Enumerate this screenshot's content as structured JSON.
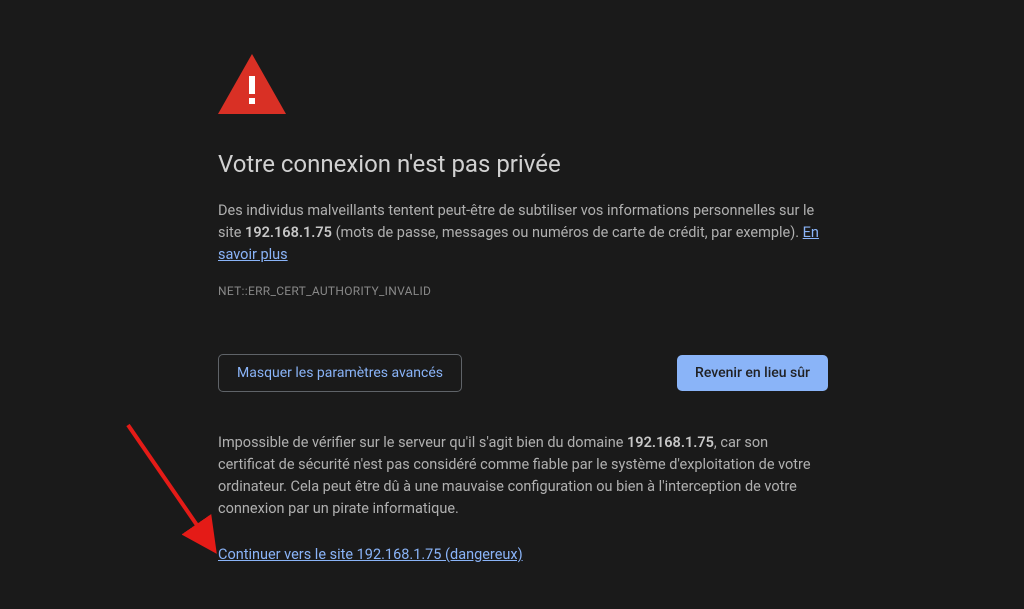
{
  "ip": "192.168.1.75",
  "title": "Votre connexion n'est pas privée",
  "body": {
    "prefix": "Des individus malveillants tentent peut-être de subtiliser vos informations personnelles sur le site ",
    "bold": "192.168.1.75",
    "suffix": " (mots de passe, messages ou numéros de carte de crédit, par exemple). ",
    "learn_more": "En savoir plus"
  },
  "error_code": "NET::ERR_CERT_AUTHORITY_INVALID",
  "buttons": {
    "hide_advanced": "Masquer les paramètres avancés",
    "back_safe": "Revenir en lieu sûr"
  },
  "details": {
    "prefix": "Impossible de vérifier sur le serveur qu'il s'agit bien du domaine ",
    "bold": "192.168.1.75",
    "suffix": ", car son certificat de sécurité n'est pas considéré comme fiable par le système d'exploitation de votre ordinateur. Cela peut être dû à une mauvaise configuration ou bien à l'interception de votre connexion par un pirate informatique."
  },
  "proceed_link": "Continuer vers le site 192.168.1.75 (dangereux)",
  "colors": {
    "warning_triangle": "#d93025",
    "link": "#8ab4f8",
    "button_fill": "#8ab4f8",
    "arrow": "#e41b17",
    "bg": "#1a1a1a"
  }
}
